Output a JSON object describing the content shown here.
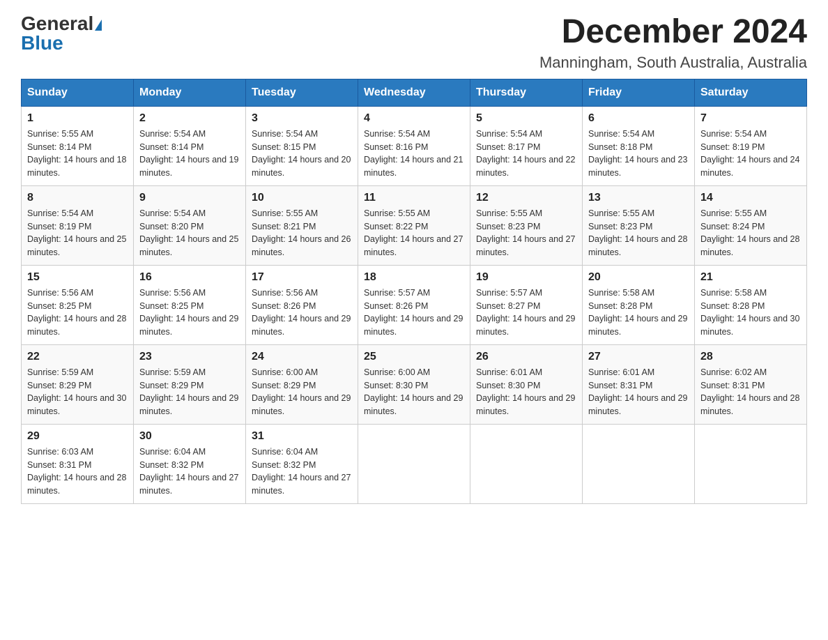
{
  "header": {
    "logo_general": "General",
    "logo_blue": "Blue",
    "month_title": "December 2024",
    "location": "Manningham, South Australia, Australia"
  },
  "weekdays": [
    "Sunday",
    "Monday",
    "Tuesday",
    "Wednesday",
    "Thursday",
    "Friday",
    "Saturday"
  ],
  "weeks": [
    [
      {
        "day": "1",
        "sunrise": "5:55 AM",
        "sunset": "8:14 PM",
        "daylight": "14 hours and 18 minutes."
      },
      {
        "day": "2",
        "sunrise": "5:54 AM",
        "sunset": "8:14 PM",
        "daylight": "14 hours and 19 minutes."
      },
      {
        "day": "3",
        "sunrise": "5:54 AM",
        "sunset": "8:15 PM",
        "daylight": "14 hours and 20 minutes."
      },
      {
        "day": "4",
        "sunrise": "5:54 AM",
        "sunset": "8:16 PM",
        "daylight": "14 hours and 21 minutes."
      },
      {
        "day": "5",
        "sunrise": "5:54 AM",
        "sunset": "8:17 PM",
        "daylight": "14 hours and 22 minutes."
      },
      {
        "day": "6",
        "sunrise": "5:54 AM",
        "sunset": "8:18 PM",
        "daylight": "14 hours and 23 minutes."
      },
      {
        "day": "7",
        "sunrise": "5:54 AM",
        "sunset": "8:19 PM",
        "daylight": "14 hours and 24 minutes."
      }
    ],
    [
      {
        "day": "8",
        "sunrise": "5:54 AM",
        "sunset": "8:19 PM",
        "daylight": "14 hours and 25 minutes."
      },
      {
        "day": "9",
        "sunrise": "5:54 AM",
        "sunset": "8:20 PM",
        "daylight": "14 hours and 25 minutes."
      },
      {
        "day": "10",
        "sunrise": "5:55 AM",
        "sunset": "8:21 PM",
        "daylight": "14 hours and 26 minutes."
      },
      {
        "day": "11",
        "sunrise": "5:55 AM",
        "sunset": "8:22 PM",
        "daylight": "14 hours and 27 minutes."
      },
      {
        "day": "12",
        "sunrise": "5:55 AM",
        "sunset": "8:23 PM",
        "daylight": "14 hours and 27 minutes."
      },
      {
        "day": "13",
        "sunrise": "5:55 AM",
        "sunset": "8:23 PM",
        "daylight": "14 hours and 28 minutes."
      },
      {
        "day": "14",
        "sunrise": "5:55 AM",
        "sunset": "8:24 PM",
        "daylight": "14 hours and 28 minutes."
      }
    ],
    [
      {
        "day": "15",
        "sunrise": "5:56 AM",
        "sunset": "8:25 PM",
        "daylight": "14 hours and 28 minutes."
      },
      {
        "day": "16",
        "sunrise": "5:56 AM",
        "sunset": "8:25 PM",
        "daylight": "14 hours and 29 minutes."
      },
      {
        "day": "17",
        "sunrise": "5:56 AM",
        "sunset": "8:26 PM",
        "daylight": "14 hours and 29 minutes."
      },
      {
        "day": "18",
        "sunrise": "5:57 AM",
        "sunset": "8:26 PM",
        "daylight": "14 hours and 29 minutes."
      },
      {
        "day": "19",
        "sunrise": "5:57 AM",
        "sunset": "8:27 PM",
        "daylight": "14 hours and 29 minutes."
      },
      {
        "day": "20",
        "sunrise": "5:58 AM",
        "sunset": "8:28 PM",
        "daylight": "14 hours and 29 minutes."
      },
      {
        "day": "21",
        "sunrise": "5:58 AM",
        "sunset": "8:28 PM",
        "daylight": "14 hours and 30 minutes."
      }
    ],
    [
      {
        "day": "22",
        "sunrise": "5:59 AM",
        "sunset": "8:29 PM",
        "daylight": "14 hours and 30 minutes."
      },
      {
        "day": "23",
        "sunrise": "5:59 AM",
        "sunset": "8:29 PM",
        "daylight": "14 hours and 29 minutes."
      },
      {
        "day": "24",
        "sunrise": "6:00 AM",
        "sunset": "8:29 PM",
        "daylight": "14 hours and 29 minutes."
      },
      {
        "day": "25",
        "sunrise": "6:00 AM",
        "sunset": "8:30 PM",
        "daylight": "14 hours and 29 minutes."
      },
      {
        "day": "26",
        "sunrise": "6:01 AM",
        "sunset": "8:30 PM",
        "daylight": "14 hours and 29 minutes."
      },
      {
        "day": "27",
        "sunrise": "6:01 AM",
        "sunset": "8:31 PM",
        "daylight": "14 hours and 29 minutes."
      },
      {
        "day": "28",
        "sunrise": "6:02 AM",
        "sunset": "8:31 PM",
        "daylight": "14 hours and 28 minutes."
      }
    ],
    [
      {
        "day": "29",
        "sunrise": "6:03 AM",
        "sunset": "8:31 PM",
        "daylight": "14 hours and 28 minutes."
      },
      {
        "day": "30",
        "sunrise": "6:04 AM",
        "sunset": "8:32 PM",
        "daylight": "14 hours and 27 minutes."
      },
      {
        "day": "31",
        "sunrise": "6:04 AM",
        "sunset": "8:32 PM",
        "daylight": "14 hours and 27 minutes."
      },
      null,
      null,
      null,
      null
    ]
  ],
  "labels": {
    "sunrise_prefix": "Sunrise: ",
    "sunset_prefix": "Sunset: ",
    "daylight_prefix": "Daylight: "
  }
}
